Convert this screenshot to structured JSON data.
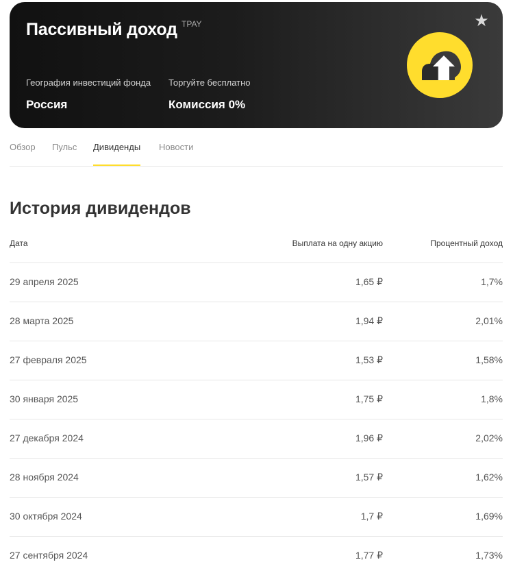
{
  "hero": {
    "title": "Пассивный доход",
    "ticker": "TPAY",
    "geography_label": "География инвестиций фонда",
    "geography_value": "Россия",
    "trade_label": "Торгуйте бесплатно",
    "trade_value": "Комиссия 0%",
    "star_icon": "★",
    "logo_color": "#ffdd2d"
  },
  "tabs": [
    {
      "label": "Обзор"
    },
    {
      "label": "Пульс"
    },
    {
      "label": "Дивиденды",
      "active": true
    },
    {
      "label": "Новости"
    }
  ],
  "section": {
    "title": "История дивидендов"
  },
  "table": {
    "headers": {
      "date": "Дата",
      "payout": "Выплата на одну акцию",
      "yield": "Процентный доход"
    },
    "rows": [
      {
        "date": "29 апреля 2025",
        "payout": "1,65 ₽",
        "yield": "1,7%"
      },
      {
        "date": "28 марта 2025",
        "payout": "1,94 ₽",
        "yield": "2,01%"
      },
      {
        "date": "27 февраля 2025",
        "payout": "1,53 ₽",
        "yield": "1,58%"
      },
      {
        "date": "30 января 2025",
        "payout": "1,75 ₽",
        "yield": "1,8%"
      },
      {
        "date": "27 декабря 2024",
        "payout": "1,96 ₽",
        "yield": "2,02%"
      },
      {
        "date": "28 ноября 2024",
        "payout": "1,57 ₽",
        "yield": "1,62%"
      },
      {
        "date": "30 октября 2024",
        "payout": "1,7 ₽",
        "yield": "1,69%"
      },
      {
        "date": "27 сентября 2024",
        "payout": "1,77 ₽",
        "yield": "1,73%"
      }
    ]
  }
}
